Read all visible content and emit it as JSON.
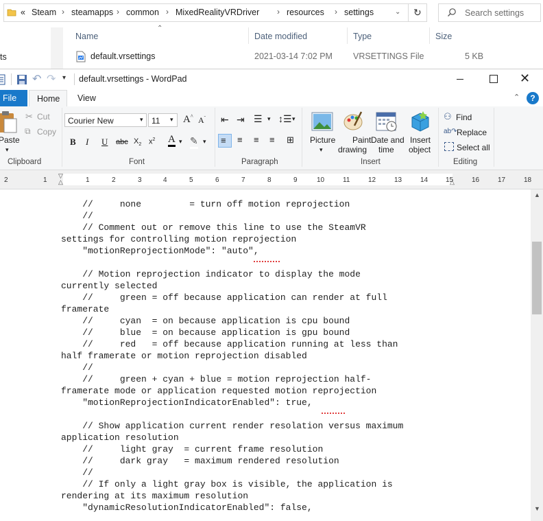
{
  "explorer": {
    "breadcrumb_prefix": "«",
    "breadcrumbs": [
      "Steam",
      "steamapps",
      "common",
      "MixedRealityVRDriver",
      "resources",
      "settings"
    ],
    "search_placeholder": "Search settings",
    "columns": [
      "Name",
      "Date modified",
      "Type",
      "Size"
    ],
    "file": {
      "name": "default.vrsettings",
      "date": "2021-03-14 7:02 PM",
      "type": "VRSETTINGS File",
      "size": "5 KB"
    },
    "left_fragment": "ts"
  },
  "wordpad": {
    "title": "default.vrsettings - WordPad",
    "tabs": {
      "file": "File",
      "home": "Home",
      "view": "View"
    },
    "clipboard": {
      "paste": "Paste",
      "cut": "Cut",
      "copy": "Copy",
      "label": "Clipboard"
    },
    "font": {
      "family": "Courier New",
      "size": "11",
      "label": "Font"
    },
    "paragraph": {
      "label": "Paragraph"
    },
    "insert": {
      "picture": "Picture",
      "paint1": "Paint",
      "paint2": "drawing",
      "date1": "Date and",
      "date2": "time",
      "object1": "Insert",
      "object2": "object",
      "label": "Insert"
    },
    "editing": {
      "find": "Find",
      "replace": "Replace",
      "select_all": "Select all",
      "label": "Editing"
    },
    "help": "?"
  },
  "ruler": {
    "ticks": [
      "2",
      "1",
      "1",
      "1",
      "2",
      "3",
      "4",
      "5",
      "6",
      "7",
      "8",
      "9",
      "10",
      "11",
      "12",
      "13",
      "14",
      "15",
      "16",
      "17",
      "18"
    ]
  },
  "document": {
    "lines": [
      "    //     none         = turn off motion reprojection",
      "    //",
      "    // Comment out or remove this line to use the SteamVR",
      "settings for controlling motion reprojection",
      "    \"motionReprojectionMode\": \"auto\",",
      "",
      "    // Motion reprojection indicator to display the mode",
      "currently selected",
      "    //     green = off because application can render at full",
      "framerate",
      "    //     cyan  = on because application is cpu bound",
      "    //     blue  = on because application is gpu bound",
      "    //     red   = off because application running at less than",
      "half framerate or motion reprojection disabled",
      "    //",
      "    //     green + cyan + blue = motion reprojection half-",
      "framerate mode or application requested motion reprojection",
      "    \"motionReprojectionIndicatorEnabled\": true,",
      "",
      "    // Show application current render resolation versus maximum",
      "application resolution",
      "    //     light gray  = current frame resolution",
      "    //     dark gray   = maximum rendered resolution",
      "    //",
      "    // If only a light gray box is visible, the application is",
      "rendering at its maximum resolution",
      "    \"dynamicResolutionIndicatorEnabled\": false,"
    ]
  },
  "colors": {
    "file_tab": "#1979ca",
    "accent": "#2b579a",
    "ribbon_bg": "#f5f6f7",
    "spell_underline": "#e03c3c"
  }
}
